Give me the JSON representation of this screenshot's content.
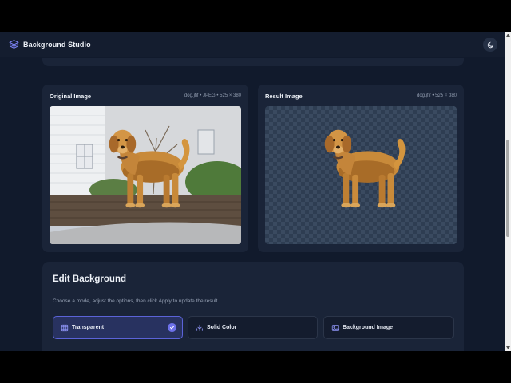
{
  "app": {
    "title": "Background Studio"
  },
  "original": {
    "title": "Original Image",
    "meta": "dog.jfif • JPEG • 525 × 380"
  },
  "result": {
    "title": "Result Image",
    "meta": "dog.jfif • 525 × 380"
  },
  "edit": {
    "title": "Edit Background",
    "description": "Choose a mode, adjust the options, then click Apply to update the result.",
    "modes": [
      {
        "label": "Transparent",
        "icon": "grid-icon",
        "selected": true
      },
      {
        "label": "Solid Color",
        "icon": "paint-bucket-icon",
        "selected": false
      },
      {
        "label": "Background Image",
        "icon": "image-icon",
        "selected": false
      }
    ]
  },
  "colors": {
    "accent": "#6d71ea",
    "background": "#111a2c",
    "card": "#1a2438"
  }
}
